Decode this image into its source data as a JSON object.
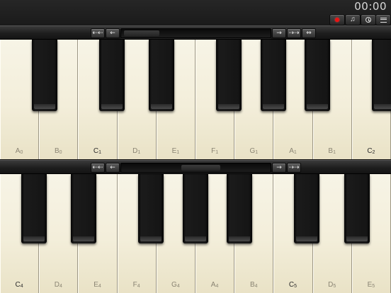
{
  "timer": "00:00",
  "toolbar": {
    "record": "record",
    "music": "♫",
    "metronome": "metronome",
    "menu": "menu"
  },
  "nav_top": {
    "back_far": "⇠⇠",
    "back": "←",
    "forward": "→",
    "forward_far": "⇢⇢",
    "swap": "⇔"
  },
  "nav_bottom": {
    "back_far": "⇠⇠",
    "back": "←",
    "forward": "→",
    "forward_far": "⇢⇢"
  },
  "keyboard_top": {
    "white_keys": [
      {
        "n": "A",
        "s": "0"
      },
      {
        "n": "B",
        "s": "0"
      },
      {
        "n": "C",
        "s": "1"
      },
      {
        "n": "D",
        "s": "1"
      },
      {
        "n": "E",
        "s": "1"
      },
      {
        "n": "F",
        "s": "1"
      },
      {
        "n": "G",
        "s": "1"
      },
      {
        "n": "A",
        "s": "1"
      },
      {
        "n": "B",
        "s": "1"
      },
      {
        "n": "C",
        "s": "2"
      }
    ]
  },
  "keyboard_bottom": {
    "white_keys": [
      {
        "n": "C",
        "s": "4"
      },
      {
        "n": "D",
        "s": "4"
      },
      {
        "n": "E",
        "s": "4"
      },
      {
        "n": "F",
        "s": "4"
      },
      {
        "n": "G",
        "s": "4"
      },
      {
        "n": "A",
        "s": "4"
      },
      {
        "n": "B",
        "s": "4"
      },
      {
        "n": "C",
        "s": "5"
      },
      {
        "n": "D",
        "s": "5"
      },
      {
        "n": "E",
        "s": "5"
      }
    ]
  },
  "colors": {
    "key_ivory": "#f3eeda",
    "record_red": "#e11"
  }
}
